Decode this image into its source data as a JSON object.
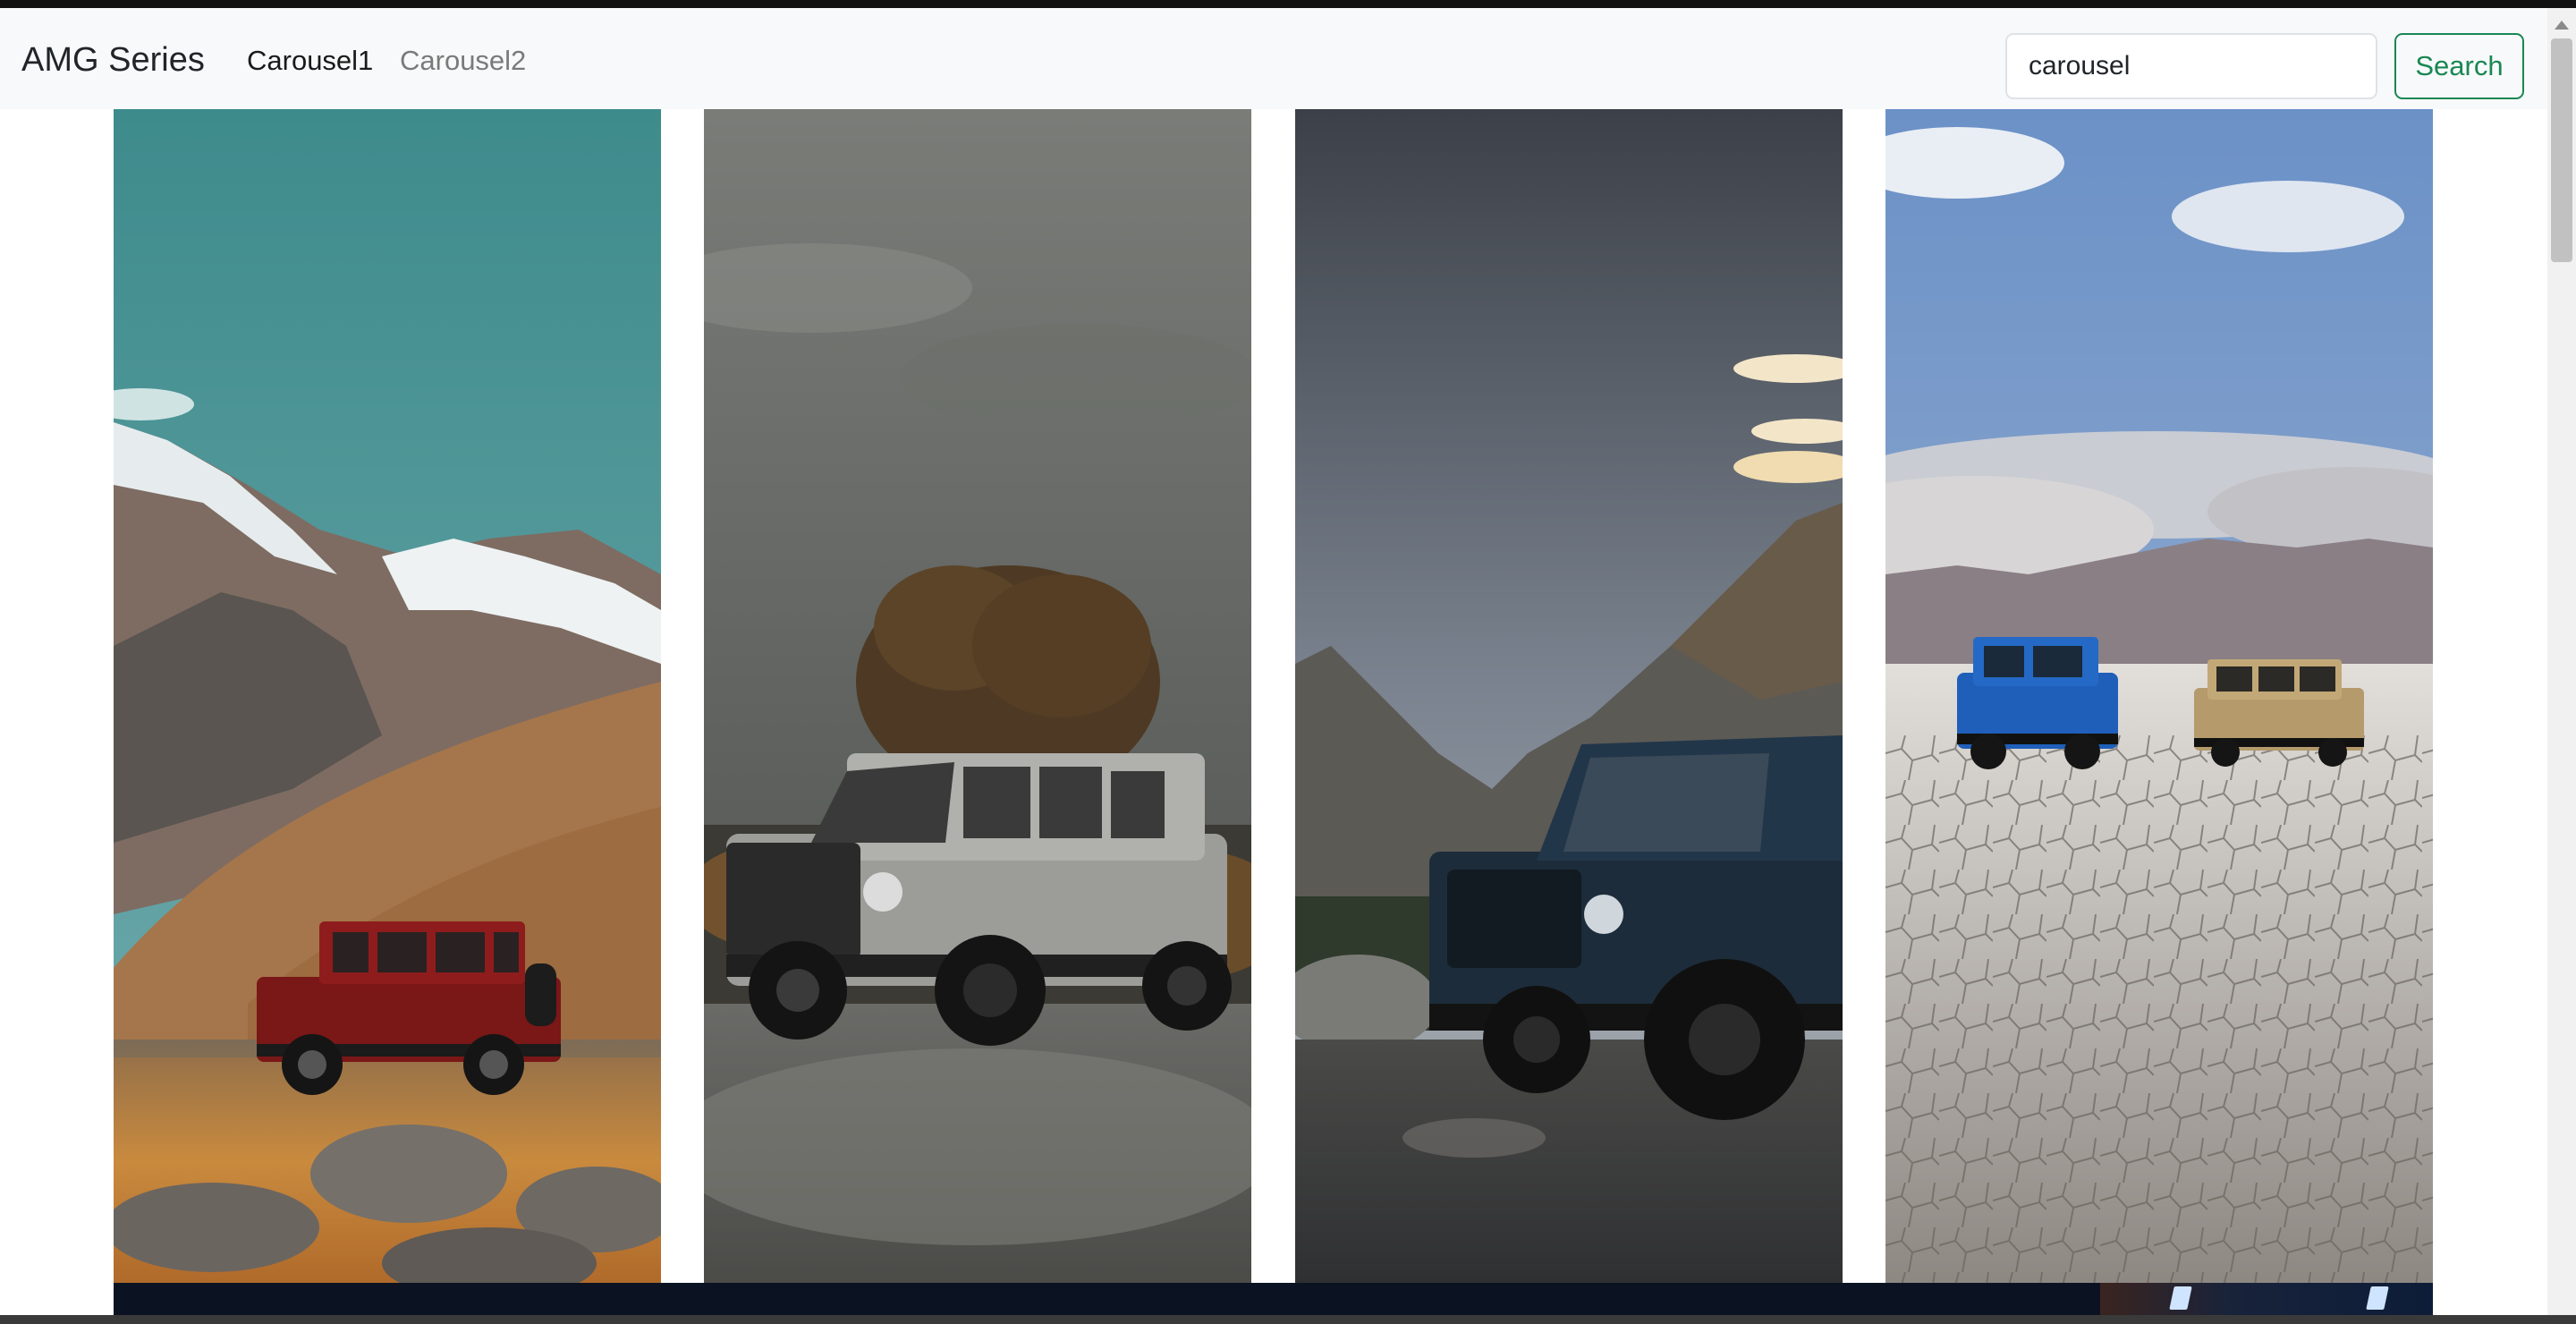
{
  "navbar": {
    "brand": "AMG Series",
    "links": [
      {
        "label": "Carousel1",
        "active": true
      },
      {
        "label": "Carousel2",
        "active": false
      }
    ],
    "search": {
      "value": "carousel",
      "placeholder": "Search",
      "button_label": "Search"
    }
  },
  "gallery": {
    "images": [
      {
        "subject": "red G-wagon in mountain meadow"
      },
      {
        "subject": "silver G-wagon on gravel road"
      },
      {
        "subject": "dark blue G-wagon by mountains"
      },
      {
        "subject": "blue and tan G-wagons on dry lakebed"
      }
    ]
  },
  "colors": {
    "navbar_bg": "#f8f9fa",
    "search_button": "#198754",
    "brand_text": "#212529"
  }
}
